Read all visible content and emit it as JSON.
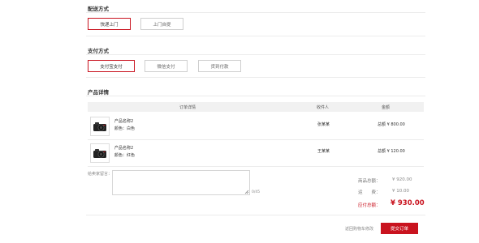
{
  "delivery": {
    "title": "配送方式",
    "options": [
      "快递上门",
      "上门自提"
    ],
    "selected_index": 0
  },
  "payment": {
    "title": "支付方式",
    "options": [
      "支付宝支付",
      "微信支付",
      "货到付款"
    ],
    "selected_index": 0
  },
  "products": {
    "title": "产品详情",
    "columns": [
      "订单详情",
      "收件人",
      "金额"
    ],
    "rows": [
      {
        "name": "产品名称2",
        "color": "颜色：白色",
        "receiver": "张某某",
        "total": "总额 ¥ 800.00",
        "image_icon": "camera-icon"
      },
      {
        "name": "产品名称2",
        "color": "颜色：红色",
        "receiver": "王某某",
        "total": "总额 ¥ 120.00",
        "image_icon": "camera-icon"
      }
    ]
  },
  "note": {
    "label": "给卖家留言：",
    "value": "",
    "counter": "0/45"
  },
  "summary": {
    "goods_label": "商品总额：",
    "goods_value": "¥ 920.00",
    "shipping_label": "运　　费：",
    "shipping_value": "¥ 10.00",
    "pay_label": "应付总额：",
    "pay_value": "¥ 930.00"
  },
  "actions": {
    "back_label": "返回购物车修改",
    "submit_label": "提交订单"
  },
  "colors": {
    "accent": "#c9131f",
    "border": "#cfcfcf",
    "header_bg": "#f1f1f1"
  }
}
